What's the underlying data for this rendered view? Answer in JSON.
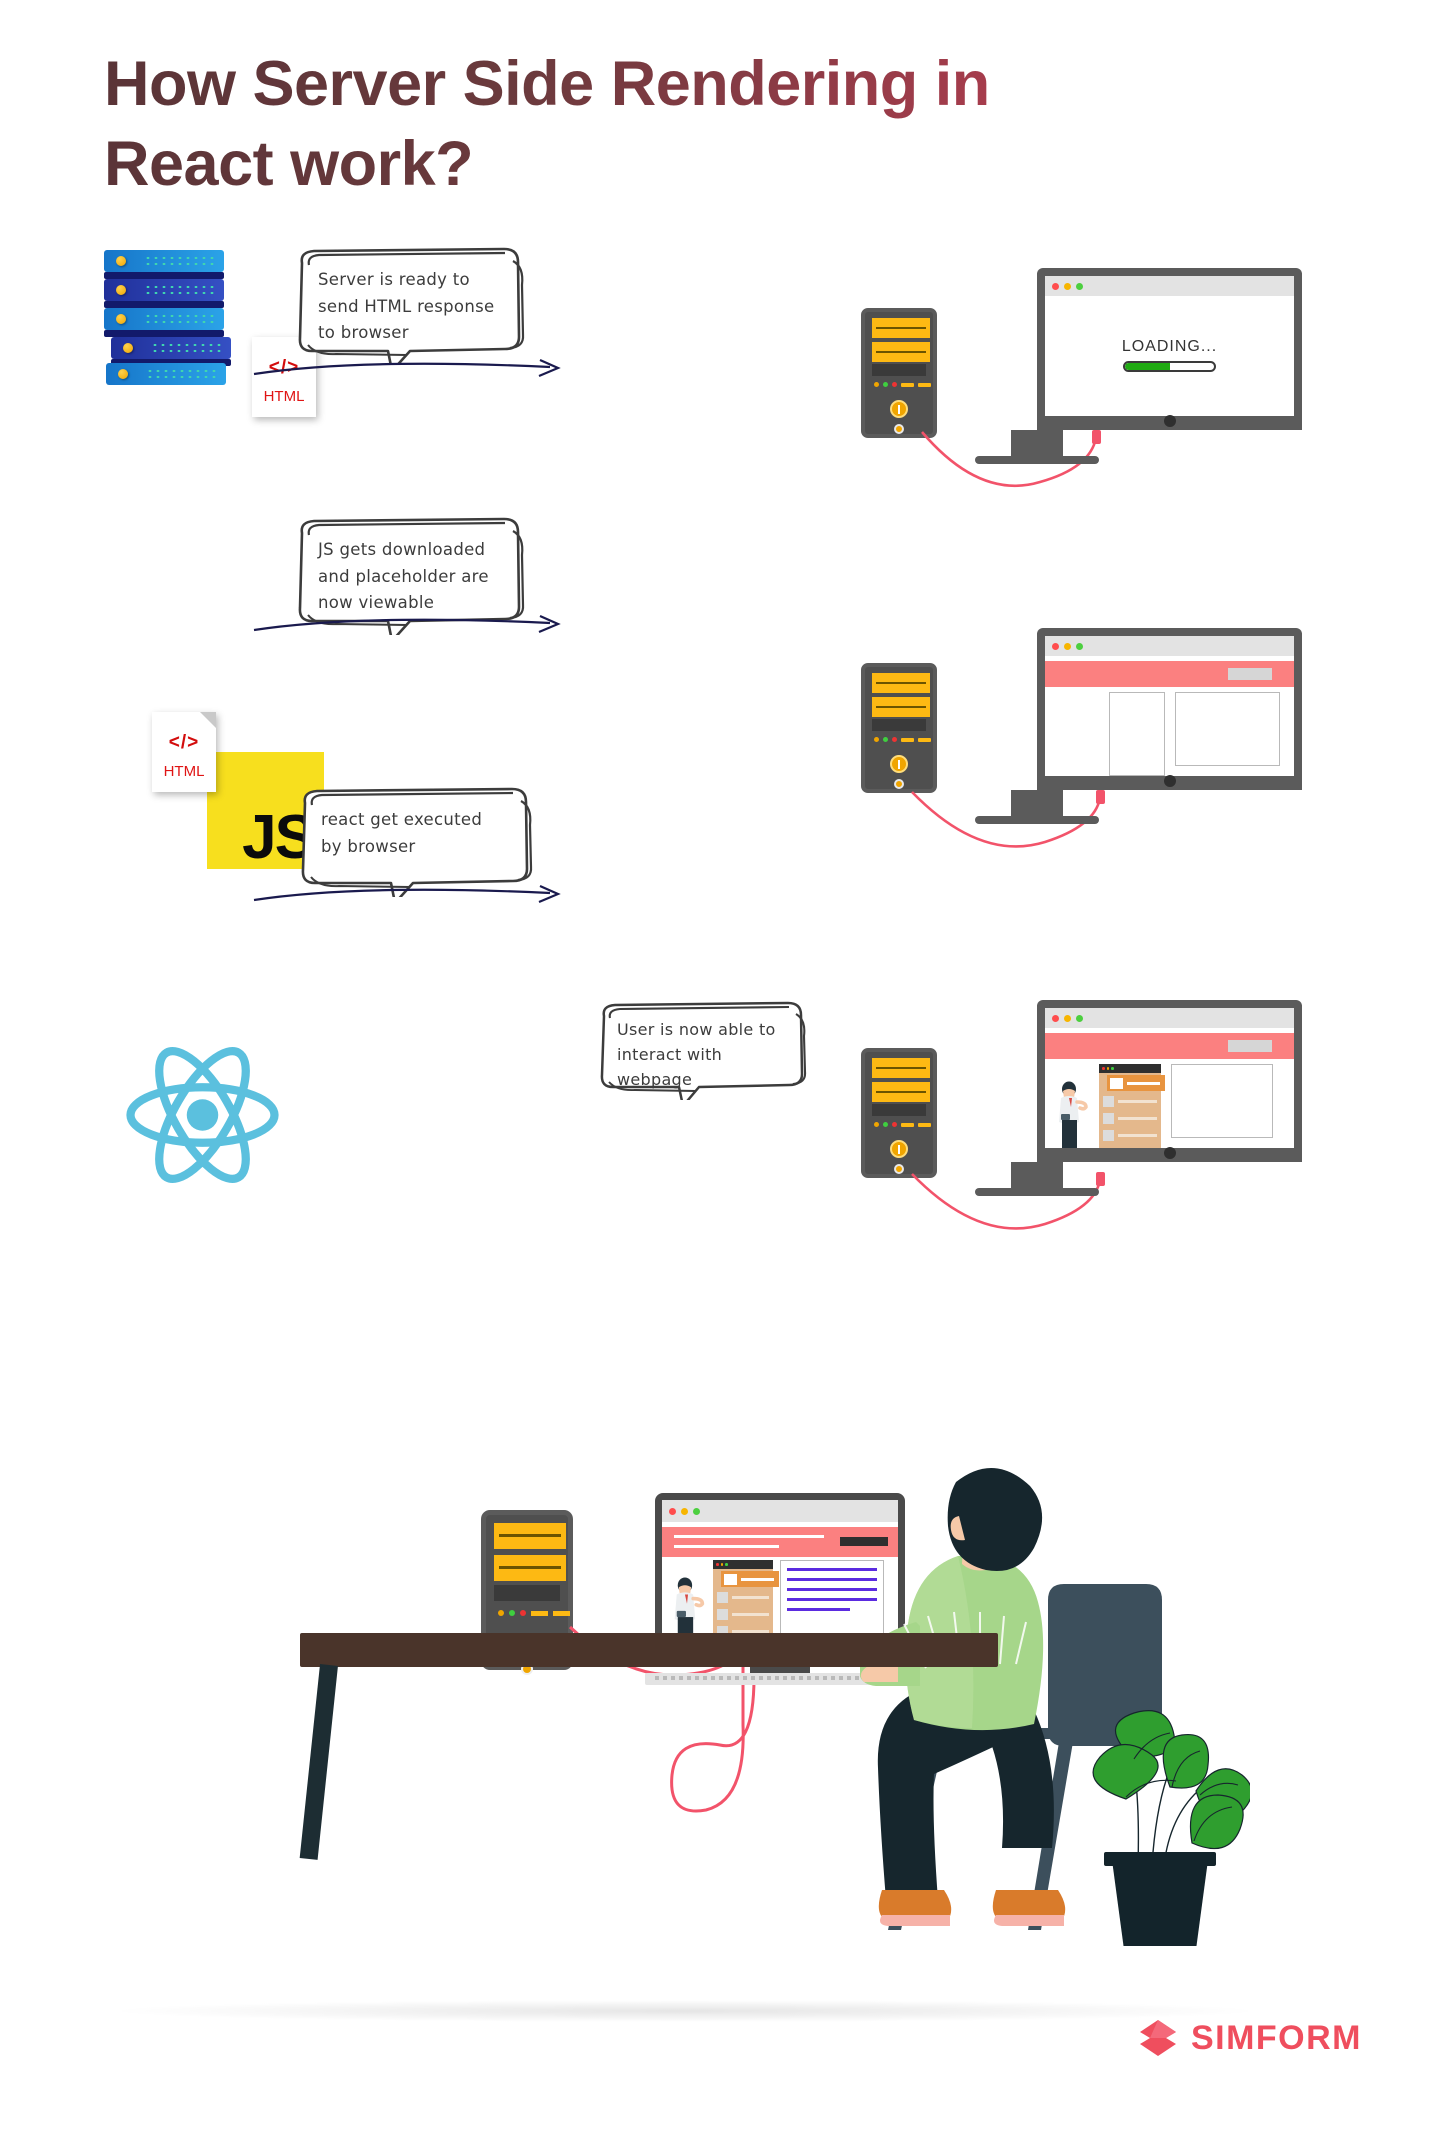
{
  "title": {
    "line1": "How Server Side Rendering in",
    "line2": "React work?",
    "gradient_from": "#5a3437",
    "gradient_to": "#c9465a"
  },
  "steps": [
    {
      "id": "step-1",
      "source_icon": "server-rack-icon",
      "file_label": "HTML",
      "file_code": "</>",
      "bubble_text": "Server is ready to\nsend HTML response\nto browser",
      "screen": {
        "state": "loading",
        "loading_text": "LOADING...",
        "progress_percent": 50,
        "progress_color": "#1faa12"
      }
    },
    {
      "id": "step-2",
      "source_icon": "js-logo-icon",
      "js_label": "JS",
      "file_label": "HTML",
      "file_code": "</>",
      "bubble_text": "JS gets downloaded\nand placeholder are\nnow viewable",
      "screen": {
        "state": "wireframe",
        "header_color": "#fb8080",
        "placeholder_count": 2
      }
    },
    {
      "id": "step-3",
      "source_icon": "react-logo-icon",
      "bubble_text": "react get executed\nby browser",
      "screen": {
        "state": "rendered",
        "header_color": "#fb8080",
        "placeholder_count": 1
      }
    }
  ],
  "final_scene": {
    "bubble_text": "User is now able to\ninteract with\nwebpage",
    "screen": {
      "state": "interactive",
      "header_color": "#fb8080"
    },
    "objects": [
      "desk",
      "computer-tower",
      "monitor",
      "keyboard",
      "person",
      "chair",
      "plant",
      "cable"
    ]
  },
  "browser_dots": [
    "#ff4d4d",
    "#f7b500",
    "#4ccf3f"
  ],
  "logo": {
    "word": "SIMFORM",
    "color": "#ef4e5e"
  },
  "colors": {
    "server_blue": "#1d7fd4",
    "server_navy": "#2a2f8f",
    "js_yellow": "#f7df1e",
    "react_cyan": "#5bc0de",
    "tower_amber": "#fdb913",
    "cable_red": "#f2536a",
    "desk_brown": "#4a342a",
    "shirt_green": "#a6d68a",
    "shoe_orange": "#d97b2b"
  }
}
